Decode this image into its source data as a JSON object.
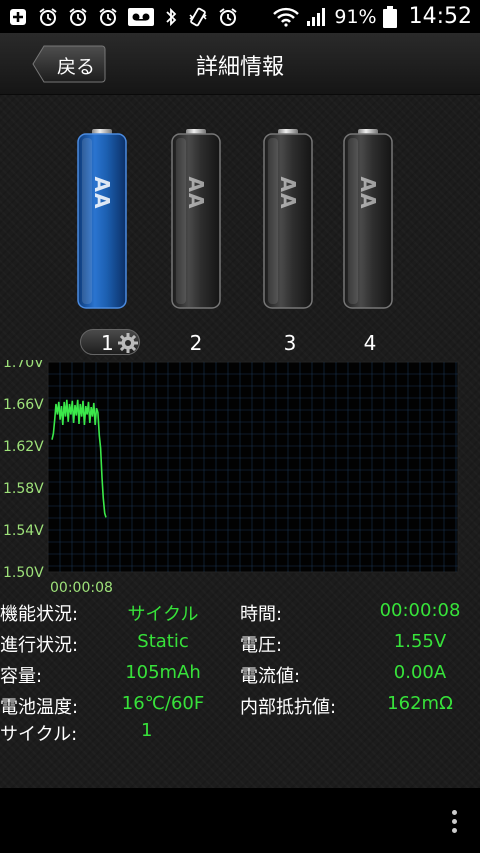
{
  "status_bar": {
    "battery_pct": "91%",
    "time": "14:52",
    "icons": [
      "add-box-icon",
      "alarm-icon",
      "alarm-icon",
      "alarm-icon",
      "voicemail-icon",
      "bluetooth-icon",
      "vibrate-icon",
      "alarm-icon",
      "wifi-icon",
      "signal-icon",
      "battery-icon"
    ]
  },
  "header": {
    "back_label": "戻る",
    "title": "詳細情報"
  },
  "batteries": [
    {
      "label": "AA",
      "slot": "1",
      "selected": true
    },
    {
      "label": "AA",
      "slot": "2",
      "selected": false
    },
    {
      "label": "AA",
      "slot": "3",
      "selected": false
    },
    {
      "label": "AA",
      "slot": "4",
      "selected": false
    }
  ],
  "colors": {
    "selected_battery": "#1c5fb0",
    "value_text": "#37e23a",
    "chart_line": "#3be84a",
    "axis_label": "#9ee27a"
  },
  "chart_data": {
    "type": "line",
    "y_ticks": [
      "1.70V",
      "1.66V",
      "1.62V",
      "1.58V",
      "1.54V",
      "1.50V"
    ],
    "ylim": [
      1.5,
      1.7
    ],
    "x_label": "00:00:08",
    "grid": true,
    "series": [
      {
        "values": [
          1.626,
          1.632,
          1.645,
          1.66,
          1.65,
          1.662,
          1.645,
          1.658,
          1.64,
          1.662,
          1.648,
          1.664,
          1.643,
          1.66,
          1.65,
          1.663,
          1.642,
          1.659,
          1.649,
          1.664,
          1.641,
          1.66,
          1.648,
          1.663,
          1.64,
          1.658,
          1.65,
          1.662,
          1.642,
          1.657,
          1.648,
          1.661,
          1.64,
          1.656,
          1.652,
          1.63,
          1.618,
          1.59,
          1.57,
          1.556,
          1.552
        ]
      }
    ]
  },
  "info": [
    {
      "label": "機能状況:",
      "value": "サイクル",
      "label2": "時間:",
      "value2": "00:00:08"
    },
    {
      "label": "進行状況:",
      "value": "Static",
      "label2": "電圧:",
      "value2": "1.55V"
    },
    {
      "label": "容量:",
      "value": "105mAh",
      "label2": "電流値:",
      "value2": "0.00A"
    },
    {
      "label": "電池温度:",
      "value": "16℃/60F",
      "label2": "内部抵抗値:",
      "value2": "162mΩ"
    },
    {
      "label": "サイクル:",
      "value": "1",
      "label2": "",
      "value2": ""
    }
  ]
}
